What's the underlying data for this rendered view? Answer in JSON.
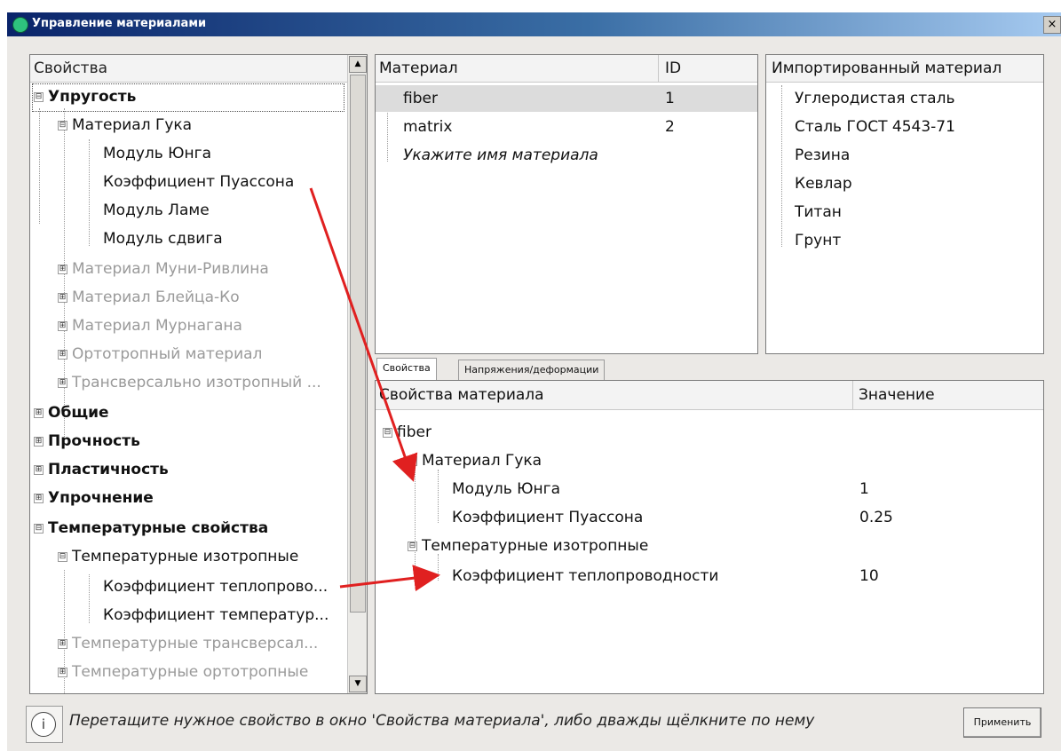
{
  "window": {
    "title": "Управление материалами",
    "close_label": "×"
  },
  "colors": {
    "arrow": "#e02020",
    "selection": "#dcdcdc",
    "title_bar_start": "#0a246a"
  },
  "properties_tree": {
    "header": "Свойства",
    "items": [
      {
        "label": "Упругость",
        "expander": "⊟",
        "bold": true
      },
      {
        "label": "Материал Гука",
        "expander": "⊟"
      },
      {
        "label": "Модуль Юнга"
      },
      {
        "label": "Коэффициент Пуассона"
      },
      {
        "label": "Модуль Ламе"
      },
      {
        "label": "Модуль сдвига"
      },
      {
        "label": "Материал Муни-Ривлина",
        "expander": "⊞",
        "disabled": true
      },
      {
        "label": "Материал Блейца-Ко",
        "expander": "⊞",
        "disabled": true
      },
      {
        "label": "Материал Мурнагана",
        "expander": "⊞",
        "disabled": true
      },
      {
        "label": "Ортотропный материал",
        "expander": "⊞",
        "disabled": true
      },
      {
        "label": "Трансверсально изотропный ...",
        "expander": "⊞",
        "disabled": true
      },
      {
        "label": "Общие",
        "expander": "⊞",
        "bold": true
      },
      {
        "label": "Прочность",
        "expander": "⊞",
        "bold": true
      },
      {
        "label": "Пластичность",
        "expander": "⊞",
        "bold": true
      },
      {
        "label": "Упрочнение",
        "expander": "⊞",
        "bold": true
      },
      {
        "label": "Температурные свойства",
        "expander": "⊟",
        "bold": true
      },
      {
        "label": "Температурные изотропные",
        "expander": "⊟"
      },
      {
        "label": "Коэффициент теплопрово..."
      },
      {
        "label": "Коэффициент температур..."
      },
      {
        "label": "Температурные трансверсал...",
        "expander": "⊞",
        "disabled": true
      },
      {
        "label": "Температурные ортотропные",
        "expander": "⊞",
        "disabled": true
      }
    ],
    "scroll_up": "▲",
    "scroll_down": "▼"
  },
  "materials": {
    "headers": {
      "name": "Материал",
      "id": "ID"
    },
    "rows": [
      {
        "name": "fiber",
        "id": "1",
        "selected": true
      },
      {
        "name": "matrix",
        "id": "2"
      }
    ],
    "placeholder": "Укажите имя материала"
  },
  "imported": {
    "header": "Импортированный материал",
    "items": [
      "Углеродистая сталь",
      "Сталь ГОСТ 4543-71",
      "Резина",
      "Кевлар",
      "Титан",
      "Грунт"
    ]
  },
  "tabs": [
    {
      "label": "Свойства",
      "active": true
    },
    {
      "label": "Напряжения/деформации"
    }
  ],
  "material_properties": {
    "headers": {
      "name": "Свойства материала",
      "value": "Значение"
    },
    "rows": [
      {
        "label": "fiber",
        "expander": "⊟",
        "value": ""
      },
      {
        "label": "Материал Гука",
        "expander": "⊟",
        "value": ""
      },
      {
        "label": "Модуль Юнга",
        "value": "1"
      },
      {
        "label": "Коэффициент Пуассона",
        "value": "0.25"
      },
      {
        "label": "Температурные изотропные",
        "expander": "⊟",
        "value": ""
      },
      {
        "label": "Коэффициент теплопроводности",
        "value": "10"
      }
    ]
  },
  "status": {
    "info_icon": "i",
    "hint": "Перетащите нужное свойство в окно 'Свойства материала', либо дважды щёлкните по нему",
    "apply_label": "Применить"
  }
}
